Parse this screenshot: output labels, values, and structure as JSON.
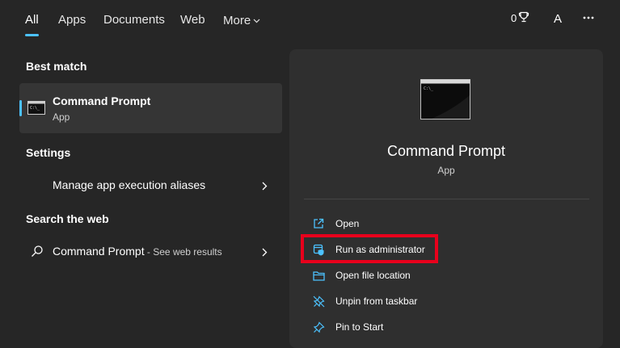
{
  "nav": {
    "tabs": [
      {
        "label": "All",
        "active": true
      },
      {
        "label": "Apps"
      },
      {
        "label": "Documents"
      },
      {
        "label": "Web"
      },
      {
        "label": "More"
      }
    ],
    "rewards_points": "0",
    "avatar_letter": "A"
  },
  "left": {
    "best_match_title": "Best match",
    "best_match": {
      "title": "Command Prompt",
      "subtitle": "App"
    },
    "settings_title": "Settings",
    "settings_item": "Manage app execution aliases",
    "web_title": "Search the web",
    "web_item": {
      "query": "Command Prompt",
      "suffix": " - See web results"
    }
  },
  "panel": {
    "title": "Command Prompt",
    "subtitle": "App",
    "actions": [
      {
        "label": "Open",
        "icon": "open-external-icon"
      },
      {
        "label": "Run as administrator",
        "icon": "shield-admin-icon"
      },
      {
        "label": "Open file location",
        "icon": "folder-icon"
      },
      {
        "label": "Unpin from taskbar",
        "icon": "unpin-icon"
      },
      {
        "label": "Pin to Start",
        "icon": "pin-icon"
      }
    ]
  },
  "colors": {
    "accent": "#4cc2ff",
    "highlight": "#e8001c",
    "background": "#262626",
    "panel": "#2f2f2f"
  }
}
